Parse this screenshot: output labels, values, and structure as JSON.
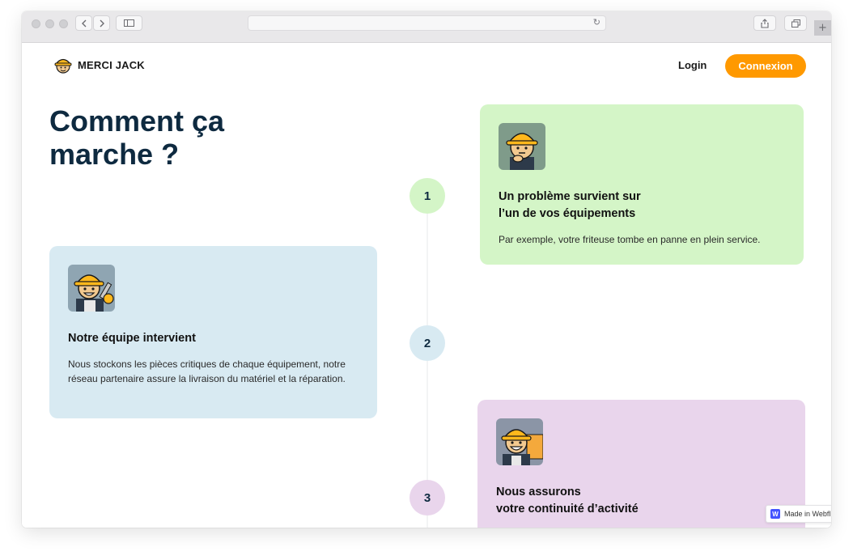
{
  "browser": {
    "back_icon": "chevron-left-icon",
    "forward_icon": "chevron-right-icon",
    "sidebar_icon": "sidebar-icon",
    "reload_icon": "reload-icon",
    "share_icon": "share-icon",
    "tabs_icon": "tabs-icon",
    "new_tab_label": "+"
  },
  "header": {
    "brand": "MERCI JACK",
    "login_label": "Login",
    "cta_label": "Connexion",
    "cta_color": "#ff9900"
  },
  "hero": {
    "title_line1": "Comment ça",
    "title_line2": "marche ?"
  },
  "steps": [
    {
      "number": "1",
      "color": "#d4f5c7"
    },
    {
      "number": "2",
      "color": "#d8eaf2"
    },
    {
      "number": "3",
      "color": "#e9d5ec"
    }
  ],
  "cards": [
    {
      "title_line1": "Un problème survient sur",
      "title_line2": "l’un de vos équipements",
      "text": "Par exemple, votre friteuse tombe en panne en plein service.",
      "color": "#d4f5c7"
    },
    {
      "title_line1": "Notre équipe intervient",
      "title_line2": "",
      "text": "Nous stockons les pièces critiques de chaque équipement, notre réseau partenaire assure la livraison du matériel et la réparation.",
      "color": "#d8eaf2"
    },
    {
      "title_line1": "Nous assurons",
      "title_line2": "votre continuité d’activité",
      "text": "",
      "color": "#e9d5ec"
    }
  ],
  "badge": {
    "label": "Made in Webfl",
    "icon_letter": "W"
  }
}
